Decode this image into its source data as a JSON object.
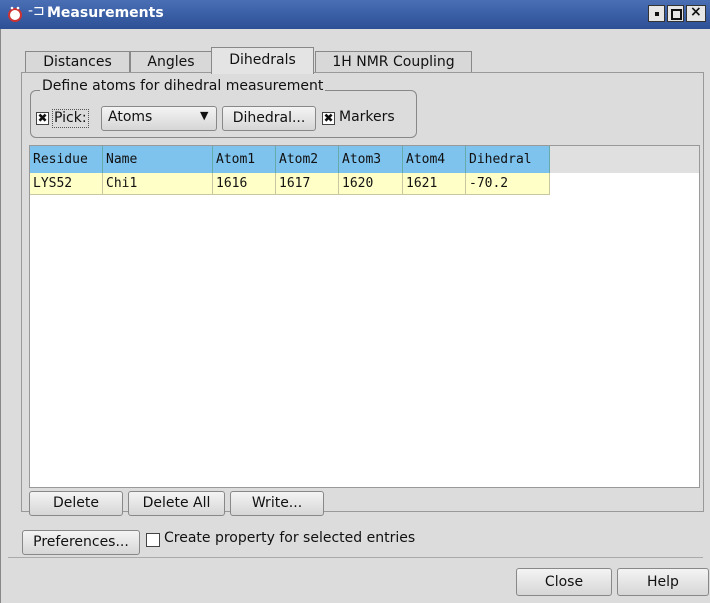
{
  "window": {
    "title": "Measurements"
  },
  "tabs": [
    "Distances",
    "Angles",
    "Dihedrals",
    "1H NMR Coupling"
  ],
  "group": {
    "title": "Define atoms for dihedral measurement",
    "pick_label": "Pick:",
    "combo_value": "Atoms",
    "dihedral_button": "Dihedral...",
    "markers_label": "Markers"
  },
  "table": {
    "columns": [
      "Residue",
      "Name",
      "Atom1",
      "Atom2",
      "Atom3",
      "Atom4",
      "Dihedral"
    ],
    "rows": [
      [
        "LYS52",
        "Chi1",
        "1616",
        "1617",
        "1620",
        "1621",
        "-70.2"
      ]
    ]
  },
  "buttons": {
    "delete": "Delete",
    "delete_all": "Delete All",
    "write": "Write..."
  },
  "bottom": {
    "preferences": "Preferences...",
    "create_property": "Create property for selected entries",
    "close": "Close",
    "help": "Help"
  }
}
